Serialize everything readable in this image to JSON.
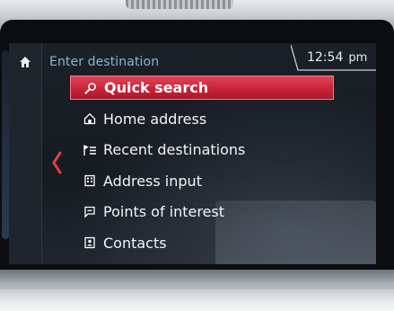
{
  "header": {
    "title": "Enter destination",
    "clock": {
      "time": "12:54",
      "period": "pm"
    }
  },
  "sidebar": {
    "home_icon": "home-icon",
    "back_icon": "chevron-left-icon"
  },
  "menu": {
    "items": [
      {
        "label": "Quick search",
        "icon": "magnifier-icon",
        "selected": true
      },
      {
        "label": "Home address",
        "icon": "home-outline-icon",
        "selected": false
      },
      {
        "label": "Recent destinations",
        "icon": "flag-list-icon",
        "selected": false
      },
      {
        "label": "Address input",
        "icon": "building-icon",
        "selected": false
      },
      {
        "label": "Points of interest",
        "icon": "speech-bubble-icon",
        "selected": false
      },
      {
        "label": "Contacts",
        "icon": "contact-card-icon",
        "selected": false
      }
    ]
  },
  "colors": {
    "accent_red": "#c8233a",
    "title_blue": "#8ab8cf",
    "screen_bg": "#181d24"
  }
}
